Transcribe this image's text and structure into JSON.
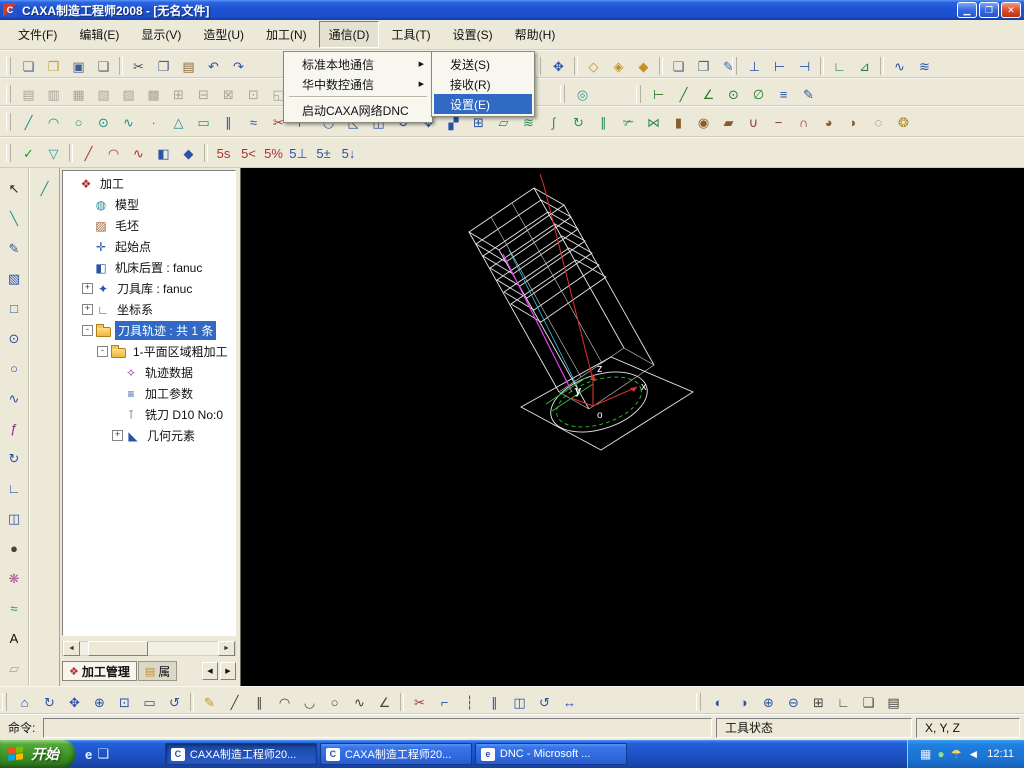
{
  "window": {
    "title": "CAXA制造工程师2008 - [无名文件]",
    "app_icon_letter": "C",
    "controls": {
      "minimize": "▁",
      "maximize": "❐",
      "close": "✕"
    }
  },
  "menubar": {
    "items": [
      {
        "name": "file",
        "label": "文件(F)"
      },
      {
        "name": "edit",
        "label": "编辑(E)"
      },
      {
        "name": "view",
        "label": "显示(V)"
      },
      {
        "name": "modeling",
        "label": "造型(U)"
      },
      {
        "name": "machining",
        "label": "加工(N)"
      },
      {
        "name": "comm",
        "label": "通信(D)",
        "open": true
      },
      {
        "name": "tools",
        "label": "工具(T)"
      },
      {
        "name": "settings",
        "label": "设置(S)"
      },
      {
        "name": "help",
        "label": "帮助(H)"
      }
    ]
  },
  "menus": {
    "comm": {
      "items": [
        {
          "name": "std-local-comm",
          "label": "标准本地通信",
          "sub": true
        },
        {
          "name": "huazhong-nc-comm",
          "label": "华中数控通信",
          "sub": true
        },
        {
          "sep": true
        },
        {
          "name": "start-caxa-dnc",
          "label": "启动CAXA网络DNC"
        }
      ]
    },
    "comm_sub": {
      "items": [
        {
          "name": "send",
          "label": "发送(S)"
        },
        {
          "name": "receive",
          "label": "接收(R)"
        },
        {
          "name": "comm-settings",
          "label": "设置(E)",
          "hl": true
        }
      ]
    }
  },
  "toolbars": {
    "row1a": [
      [
        "new-file",
        "❏",
        "#41618e"
      ],
      [
        "open-folder",
        "❒",
        "#c99b2d"
      ],
      [
        "save-file",
        "▣",
        "#41618e"
      ],
      [
        "print",
        "❑",
        "#5a5a66"
      ],
      [
        "|"
      ],
      [
        "cut",
        "✂",
        "#444c5c"
      ],
      [
        "copy",
        "❐",
        "#41618e"
      ],
      [
        "paste",
        "▤",
        "#8a6a3a"
      ],
      [
        "undo",
        "↶",
        "#2a52a8"
      ],
      [
        "redo",
        "↷",
        "#2a52a8"
      ]
    ],
    "row1b": [
      [
        "pan-view",
        "✥",
        "#2a52a8"
      ],
      [
        "|"
      ],
      [
        "display-wireframe",
        "◇",
        "#c2912a"
      ],
      [
        "display-hidden-line",
        "◈",
        "#c2912a"
      ],
      [
        "display-shaded",
        "◆",
        "#c2912a"
      ],
      [
        "|"
      ],
      [
        "new-window",
        "❏",
        "#41618e"
      ],
      [
        "copy-window",
        "❐",
        "#41618e"
      ],
      [
        "edit-pen",
        "✎",
        "#2a6cc0"
      ]
    ],
    "row1c": [
      [
        "plane-xy",
        "⊥",
        "#2a52a8"
      ],
      [
        "plane-yz",
        "⊢",
        "#2a52a8"
      ],
      [
        "plane-xz",
        "⊣",
        "#2a52a8"
      ],
      [
        "|"
      ],
      [
        "ucs-create",
        "∟",
        "#2a7a52"
      ],
      [
        "ucs-activate",
        "⊿",
        "#2a7a52"
      ],
      [
        "|"
      ],
      [
        "curve-projection",
        "∿",
        "#2a52a8"
      ],
      [
        "curve-combine",
        "≋",
        "#2a52a8"
      ]
    ],
    "row2a": [
      [
        "rough-2axis",
        "▤",
        "#9a9a90",
        true
      ],
      [
        "plane-rough",
        "▥",
        "#9a9a90",
        true
      ],
      [
        "contour-cut",
        "▦",
        "#9a9a90",
        true
      ],
      [
        "pocket-cut",
        "▧",
        "#9a9a90",
        true
      ],
      [
        "drill-cycle",
        "▨",
        "#9a9a90",
        true
      ],
      [
        "engrave-cut",
        "▩",
        "#9a9a90",
        true
      ],
      [
        "groove-cut",
        "⊞",
        "#9a9a90",
        true
      ],
      [
        "surface-rough",
        "⊟",
        "#9a9a90",
        true
      ],
      [
        "surface-finish",
        "⊠",
        "#9a9a90",
        true
      ],
      [
        "pencil-cut",
        "⊡",
        "#9a9a90",
        true
      ],
      [
        "limit-line",
        "◱",
        "#9a9a90",
        true
      ],
      [
        "combine-path",
        "◲",
        "#9a9a90",
        true
      ],
      [
        "trim-path",
        "◳",
        "#9a9a90",
        true
      ],
      [
        "simulate-verify",
        "◰",
        "#9a9a90",
        true
      ]
    ],
    "row2b": [
      [
        "solid-display",
        "◎",
        "#1f9f9f"
      ]
    ],
    "row2c": [
      [
        "dim-linear",
        "⊢",
        "#2a7a2a"
      ],
      [
        "dim-aligned",
        "╱",
        "#2a7a2a"
      ],
      [
        "dim-angular",
        "∠",
        "#2a7a2a"
      ],
      [
        "dim-radial",
        "⊙",
        "#2a7a2a"
      ],
      [
        "dim-diameter",
        "∅",
        "#2a7a2a"
      ],
      [
        "dim-text",
        "≡",
        "#2a52a8"
      ],
      [
        "dim-edit",
        "✎",
        "#2a52a8"
      ]
    ],
    "row3": [
      [
        "line",
        "╱",
        "#1f8f8f"
      ],
      [
        "arc",
        "◠",
        "#1f8f8f"
      ],
      [
        "circle",
        "○",
        "#1f8f8f"
      ],
      [
        "ellipse",
        "⊙",
        "#1f8f8f"
      ],
      [
        "spline",
        "∿",
        "#1f8f8f"
      ],
      [
        "point",
        "∙",
        "#1f8f8f"
      ],
      [
        "polygon",
        "△",
        "#1f8f8f"
      ],
      [
        "rectangle",
        "▭",
        "#1f8f8f"
      ],
      [
        "equidistant-line",
        "∥",
        "#2a52a8"
      ],
      [
        "curve-offset",
        "≈",
        "#2a52a8"
      ],
      [
        "curve-trim",
        "✂",
        "#a03030"
      ],
      [
        "curve-extend",
        "⊢",
        "#2a52a8"
      ],
      [
        "fillet",
        "◡",
        "#2a52a8"
      ],
      [
        "chamfer",
        "◺",
        "#2a52a8"
      ],
      [
        "curve-mirror",
        "◫",
        "#2a52a8"
      ],
      [
        "curve-rotate",
        "↺",
        "#2a52a8"
      ],
      [
        "curve-move",
        "✥",
        "#2a52a8"
      ],
      [
        "curve-scale",
        "▞",
        "#2a52a8"
      ],
      [
        "curve-array",
        "⊞",
        "#2a52a8"
      ],
      [
        "surface-ruled",
        "▱",
        "#2a8f5a"
      ],
      [
        "surface-loft",
        "≋",
        "#2a8f5a"
      ],
      [
        "surface-sweep",
        "∫",
        "#2a8f5a"
      ],
      [
        "surface-revolve",
        "↻",
        "#2a8f5a"
      ],
      [
        "surface-offset",
        "∥",
        "#2a8f5a"
      ],
      [
        "surface-trim",
        "✃",
        "#2a8f5a"
      ],
      [
        "surface-stitch",
        "⋈",
        "#2a8f5a"
      ],
      [
        "solid-extrude",
        "▮",
        "#8a5a2a"
      ],
      [
        "solid-revolve",
        "◉",
        "#8a5a2a"
      ],
      [
        "solid-loft",
        "▰",
        "#8a5a2a"
      ],
      [
        "boolean-union",
        "∪",
        "#8a2a52"
      ],
      [
        "boolean-subtract",
        "−",
        "#8a2a52"
      ],
      [
        "boolean-intersect",
        "∩",
        "#8a2a52"
      ],
      [
        "solid-fillet",
        "◕",
        "#8a5a2a"
      ],
      [
        "solid-chamfer",
        "◗",
        "#8a5a2a"
      ],
      [
        "solid-shell",
        "◌",
        "#8a5a2a"
      ],
      [
        "render-mode",
        "❂",
        "#b0892a"
      ]
    ],
    "row4": [
      [
        "visible-check",
        "✓",
        "#1a9c1a"
      ],
      [
        "layer-filter",
        "▽",
        "#1f9f9f"
      ],
      [
        "|"
      ],
      [
        "pick-line",
        "╱",
        "#b03030"
      ],
      [
        "pick-arc",
        "◠",
        "#b03030"
      ],
      [
        "pick-spline",
        "∿",
        "#b03030"
      ],
      [
        "pick-surface",
        "◧",
        "#2a52a8"
      ],
      [
        "pick-solid",
        "◆",
        "#2a52a8"
      ],
      [
        "|"
      ],
      [
        "snap-s5",
        "5s",
        "#b03030"
      ],
      [
        "snap-angle",
        "5<",
        "#b03030"
      ],
      [
        "snap-percent",
        "5%",
        "#b03030"
      ],
      [
        "snap-perpendicular",
        "5⊥",
        "#2a52a8"
      ],
      [
        "snap-tolerance",
        "5±",
        "#2a52a8"
      ],
      [
        "snap-step",
        "5↓",
        "#2a52a8"
      ]
    ],
    "left1": [
      [
        "select-arrow",
        "↖",
        "#222222"
      ],
      [
        "sketch-line",
        "╲",
        "#1f8f8f"
      ],
      [
        "sketch-pen",
        "✎",
        "#2a52a8"
      ],
      [
        "solid-box",
        "▧",
        "#2a52a8"
      ],
      [
        "sketch-rect",
        "□",
        "#2a52a8"
      ],
      [
        "sketch-circle",
        "⊙",
        "#2a52a8"
      ],
      [
        "sketch-ellipse",
        "○",
        "#2a52a8"
      ],
      [
        "sketch-spline",
        "∿",
        "#2a52a8"
      ],
      [
        "formula-curve",
        "ƒ",
        "#8a2a8a"
      ],
      [
        "rotate-tool",
        "↻",
        "#2a52a8"
      ],
      [
        "coordinate-axis",
        "∟",
        "#2a52a8"
      ],
      [
        "mirror-tool",
        "◫",
        "#2a52a8"
      ],
      [
        "sphere-tool",
        "●",
        "#444444"
      ],
      [
        "pattern-tool",
        "❋",
        "#b0589a"
      ],
      [
        "wave-surface",
        "≈",
        "#2a8f5a"
      ],
      [
        "text-tool",
        "A",
        "#111111"
      ],
      [
        "eraser-tool",
        "▱",
        "#9a9a90",
        true
      ],
      [
        "fill-tool",
        "▒",
        "#9a9a90",
        true
      ]
    ],
    "left2": [
      [
        "feature-line",
        "╱",
        "#1f8f8f"
      ]
    ],
    "bottomA": [
      [
        "home-view",
        "⌂",
        "#2a52a8"
      ],
      [
        "rotate-view",
        "↻",
        "#2a52a8"
      ],
      [
        "pan-view-2",
        "✥",
        "#2a52a8"
      ],
      [
        "zoom-in",
        "⊕",
        "#2a52a8"
      ],
      [
        "zoom-window",
        "⊡",
        "#2a52a8"
      ],
      [
        "zoom-all",
        "▭",
        "#2a52a8"
      ],
      [
        "refresh-view",
        "↺",
        "#2a52a8"
      ],
      [
        "|"
      ],
      [
        "draw-pencil",
        "✎",
        "#c2912a"
      ],
      [
        "draw-line",
        "╱",
        "#444444"
      ],
      [
        "draw-parallel",
        "∥",
        "#444444"
      ],
      [
        "draw-arc",
        "◠",
        "#444444"
      ],
      [
        "draw-arc-2",
        "◡",
        "#444444"
      ],
      [
        "draw-circle",
        "○",
        "#444444"
      ],
      [
        "draw-spline",
        "∿",
        "#444444"
      ],
      [
        "draw-polyline",
        "∠",
        "#444444"
      ],
      [
        "|"
      ],
      [
        "edit-trim",
        "✂",
        "#a03030"
      ],
      [
        "edit-corner",
        "⌐",
        "#2a52a8"
      ],
      [
        "edit-break",
        "┆",
        "#2a52a8"
      ],
      [
        "edit-offset",
        "∥",
        "#2a52a8"
      ],
      [
        "edit-mirror",
        "◫",
        "#2a52a8"
      ],
      [
        "edit-rotate",
        "↺",
        "#2a52a8"
      ],
      [
        "edit-stretch",
        "↔",
        "#2a52a8"
      ]
    ],
    "bottomB": [
      [
        "flip-horizontal",
        "◐",
        "#2a52a8"
      ],
      [
        "flip-vertical",
        "◑",
        "#2a52a8"
      ],
      [
        "center-mark",
        "⊕",
        "#2a52a8"
      ],
      [
        "balance-view",
        "⊖",
        "#2a52a8"
      ],
      [
        "grid-toggle",
        "⊞",
        "#444444"
      ],
      [
        "ortho-toggle",
        "∟",
        "#444444"
      ],
      [
        "layer-window",
        "❏",
        "#444444"
      ],
      [
        "property-window",
        "▤",
        "#444444"
      ]
    ]
  },
  "tree": {
    "items": [
      {
        "name": "process-root",
        "label": "加工",
        "depth": 0,
        "icon": "❖",
        "iconname": "process",
        "color": "#b03030"
      },
      {
        "name": "model",
        "label": "模型",
        "depth": 1,
        "icon": "◍",
        "iconname": "model",
        "color": "#1f8f8f"
      },
      {
        "name": "blank",
        "label": "毛坯",
        "depth": 1,
        "icon": "▨",
        "iconname": "blank",
        "color": "#9a5a2a"
      },
      {
        "name": "start-point",
        "label": "起始点",
        "depth": 1,
        "icon": "✛",
        "iconname": "start-point",
        "color": "#2a52a8"
      },
      {
        "name": "machine-post",
        "label": "机床后置 : fanuc",
        "depth": 1,
        "icon": "◧",
        "iconname": "machine-post",
        "color": "#2a52a8"
      },
      {
        "name": "tool-library",
        "label": "刀具库 : fanuc",
        "depth": 1,
        "exp": "+",
        "icon": "✦",
        "iconname": "tool-library",
        "color": "#2a52a8"
      },
      {
        "name": "coordinate-system",
        "label": "坐标系",
        "depth": 1,
        "exp": "+",
        "icon": "∟",
        "iconname": "coordinate-system",
        "color": "#2a52a8"
      },
      {
        "name": "toolpath",
        "label": "刀具轨迹 : 共 1 条",
        "depth": 1,
        "exp": "-",
        "icon": "folder",
        "sel": true
      },
      {
        "name": "plane-area-rough",
        "label": "1-平面区域粗加工",
        "depth": 2,
        "exp": "-",
        "icon": "folder"
      },
      {
        "name": "path-data",
        "label": "轨迹数据",
        "depth": 3,
        "icon": "✧",
        "iconname": "path-data",
        "color": "#8a2a9a"
      },
      {
        "name": "machining-params",
        "label": "加工参数",
        "depth": 3,
        "icon": "≡",
        "iconname": "machining-params",
        "color": "#2a52a8"
      },
      {
        "name": "mill-tool",
        "label": "铣刀 D10 No:0",
        "depth": 3,
        "icon": "⊺",
        "iconname": "mill-tool",
        "color": "#5a5aa0"
      },
      {
        "name": "geometry-elements",
        "label": "几何元素",
        "depth": 3,
        "exp": "+",
        "icon": "◣",
        "iconname": "geometry",
        "color": "#2a52a8"
      }
    ],
    "scroll": {
      "left": "◄",
      "right": "►"
    },
    "tabs": [
      {
        "name": "machining-manager",
        "label": "加工管理",
        "glyph": "❖",
        "color": "#b03030",
        "active": true
      },
      {
        "name": "properties",
        "label": "属",
        "glyph": "▤",
        "color": "#c2912a"
      }
    ],
    "tab_arrows": {
      "left": "◀",
      "right": "▶"
    }
  },
  "viewport": {
    "axes": {
      "x": "x",
      "y": "y",
      "z": "z",
      "o": "o"
    }
  },
  "command": {
    "label": "命令:",
    "value": "",
    "tool_status": "工具状态",
    "coords": "X, Y, Z"
  },
  "taskbar": {
    "start_label": "开始",
    "quick": [
      [
        "ie-quicklaunch",
        "e",
        "#eaf2ff"
      ],
      [
        "desktop-quicklaunch",
        "❏",
        "#d8e8ff"
      ]
    ],
    "buttons": [
      {
        "label": "CAXA制造工程师20...",
        "glyph": "C",
        "active": true
      },
      {
        "label": "CAXA制造工程师20...",
        "glyph": "C"
      },
      {
        "label": "DNC - Microsoft ...",
        "glyph": "e"
      }
    ],
    "tray": [
      [
        "ime-tray-icon",
        "▦",
        "#e8f0ff"
      ],
      [
        "messenger-tray-icon",
        "●",
        "#8ae08a"
      ],
      [
        "antivirus-tray-icon",
        "☂",
        "#ffd060"
      ],
      [
        "volume-tray-icon",
        "◄",
        "#ffffff"
      ]
    ],
    "clock": "12:11"
  }
}
